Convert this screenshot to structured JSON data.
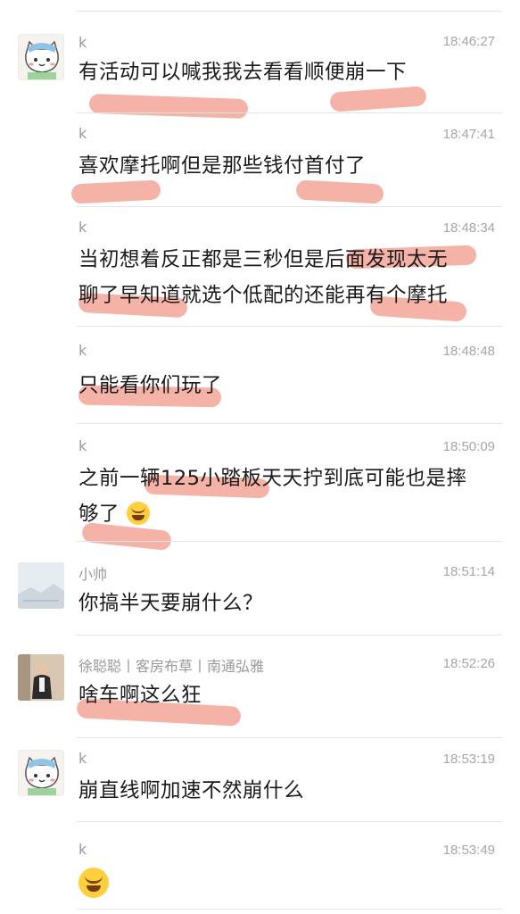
{
  "messages": [
    {
      "name": "k",
      "time": "18:46:27",
      "text": "有活动可以喊我我去看看顺便崩一下"
    },
    {
      "name": "k",
      "time": "18:47:41",
      "text": "喜欢摩托啊但是那些钱付首付了"
    },
    {
      "name": "k",
      "time": "18:48:34",
      "text1": "当初想着反正都是三秒但是后面发现太无",
      "text2": "聊了早知道就选个低配的还能再有个摩托"
    },
    {
      "name": "k",
      "time": "18:48:48",
      "text": "只能看你们玩了"
    },
    {
      "name": "k",
      "time": "18:50:09",
      "text1": "之前一辆125小踏板天天拧到底可能也是摔",
      "text2": "够了"
    },
    {
      "name": "小帅",
      "time": "18:51:14",
      "text": "你搞半天要崩什么？"
    },
    {
      "name": "徐聪聪丨客房布草丨南通弘雅",
      "time": "18:52:26",
      "text": "啥车啊这么狂"
    },
    {
      "name": "k",
      "time": "18:53:19",
      "text": "崩直线啊加速不然崩什么"
    },
    {
      "name": "k",
      "time": "18:53:49"
    }
  ],
  "colors": {
    "highlight": "#f19a8a",
    "name": "#9a9a9a",
    "text": "#1a1a1a"
  }
}
